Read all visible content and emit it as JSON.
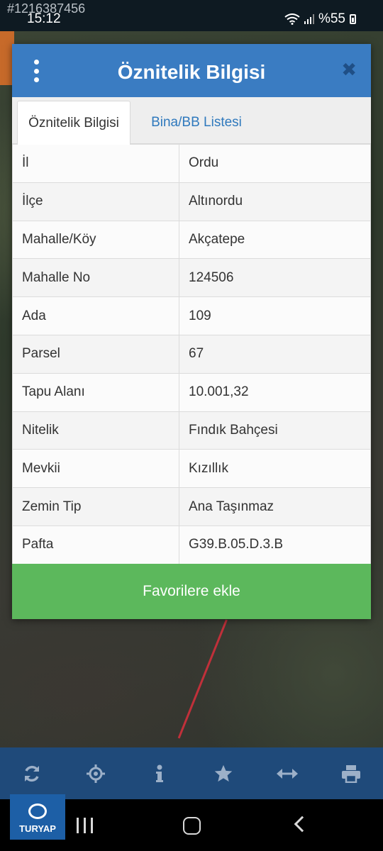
{
  "status_bar": {
    "watermark_id": "#1216387456",
    "time": "15:12",
    "battery": "%55"
  },
  "dialog": {
    "title": "Öznitelik Bilgisi",
    "tabs": [
      {
        "label": "Öznitelik Bilgisi",
        "active": true
      },
      {
        "label": "Bina/BB Listesi",
        "active": false
      }
    ],
    "rows": [
      {
        "key": "İl",
        "value": "Ordu"
      },
      {
        "key": "İlçe",
        "value": "Altınordu"
      },
      {
        "key": "Mahalle/Köy",
        "value": "Akçatepe"
      },
      {
        "key": "Mahalle No",
        "value": "124506"
      },
      {
        "key": "Ada",
        "value": "109"
      },
      {
        "key": "Parsel",
        "value": "67"
      },
      {
        "key": "Tapu Alanı",
        "value": "10.001,32"
      },
      {
        "key": "Nitelik",
        "value": "Fındık Bahçesi"
      },
      {
        "key": "Mevkii",
        "value": "Kızıllık"
      },
      {
        "key": "Zemin Tip",
        "value": "Ana Taşınmaz"
      },
      {
        "key": "Pafta",
        "value": "G39.B.05.D.3.B"
      }
    ],
    "favorite_button": "Favorilere ekle"
  },
  "toolbar": {
    "icons": [
      "refresh-icon",
      "crosshair-icon",
      "info-icon",
      "star-icon",
      "measure-icon",
      "print-icon"
    ]
  },
  "logo": {
    "text": "TURYAP"
  },
  "colors": {
    "header": "#3a7cc2",
    "favorite_button": "#5cb85c",
    "toolbar": "#1f4a7a"
  }
}
